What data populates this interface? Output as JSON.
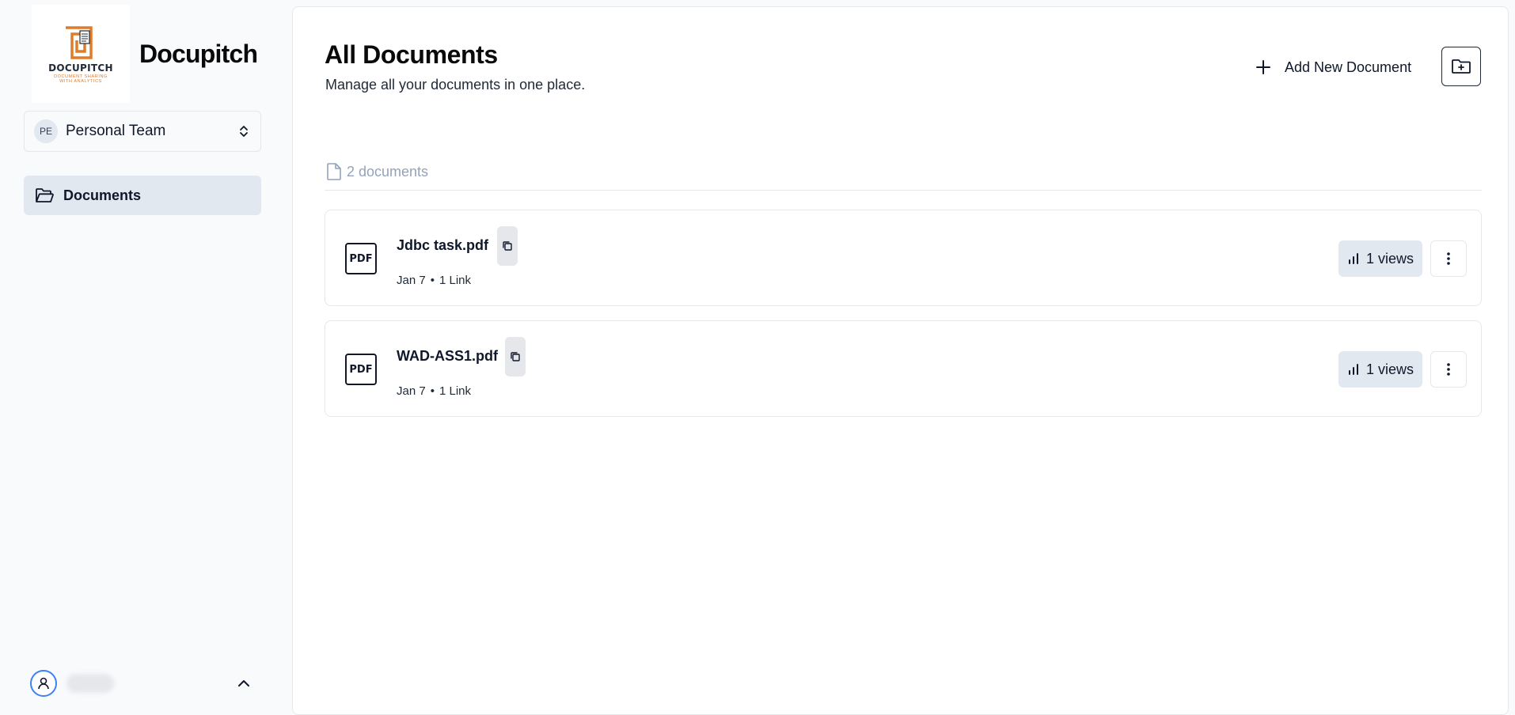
{
  "brand": {
    "name": "Docupitch",
    "logo_text": "DOCUPITCH",
    "logo_tagline": "DOCUMENT SHARING WITH ANALYTICS"
  },
  "team": {
    "avatar_initials": "PE",
    "name": "Personal Team"
  },
  "sidebar": {
    "items": [
      {
        "label": "Documents",
        "icon": "folder-open-icon",
        "active": true
      }
    ]
  },
  "header": {
    "title": "All Documents",
    "subtitle": "Manage all your documents in one place.",
    "add_label": "Add New Document"
  },
  "documents": {
    "count_label": "2 documents",
    "items": [
      {
        "name": "Jdbc task.pdf",
        "type": "PDF",
        "date": "Jan 7",
        "links": "1 Link",
        "views": "1 views"
      },
      {
        "name": "WAD-ASS1.pdf",
        "type": "PDF",
        "date": "Jan 7",
        "links": "1 Link",
        "views": "1 views"
      }
    ]
  },
  "meta_separator": "•",
  "colors": {
    "accent_orange": "#e07b2a",
    "active_nav_bg": "#e2e8f0",
    "user_ring": "#3b82f6"
  }
}
